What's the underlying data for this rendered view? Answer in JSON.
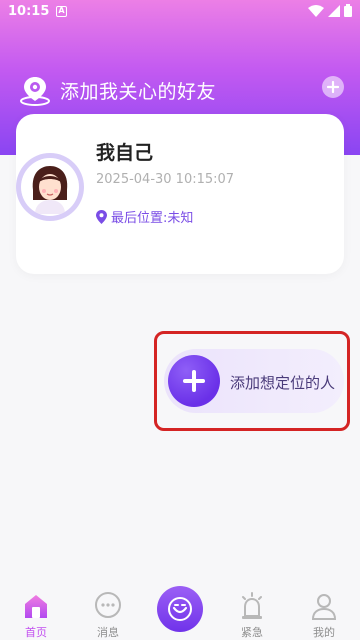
{
  "status_bar": {
    "time": "10:15",
    "notif_letter": "A"
  },
  "header": {
    "title": "添加我关心的好友"
  },
  "self_card": {
    "name": "我自己",
    "time": "2025-04-30 10:15:07",
    "location": "最后位置:未知"
  },
  "add_person": {
    "label": "添加想定位的人"
  },
  "tabbar": {
    "items": [
      {
        "label": "首页",
        "icon": "home-icon",
        "active": true
      },
      {
        "label": "消息",
        "icon": "message-icon",
        "active": false
      },
      {
        "label": "",
        "icon": "smile-center-icon",
        "active": false
      },
      {
        "label": "紧急",
        "icon": "alarm-icon",
        "active": false
      },
      {
        "label": "我的",
        "icon": "user-icon",
        "active": false
      }
    ]
  },
  "colors": {
    "accent": "#7a4de6",
    "highlight": "#d42424",
    "active_tab": "#c24ff0"
  }
}
